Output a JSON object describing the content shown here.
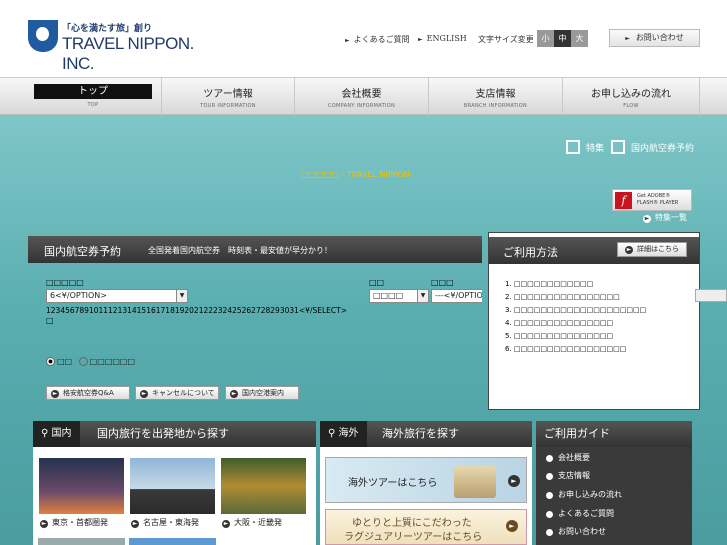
{
  "header": {
    "logo_tagline": "「心を満たす旅」創り",
    "logo_text": "TRAVEL NIPPON. INC.",
    "links": [
      "よくあるご質問",
      "ENGLISH"
    ],
    "font_size_label": "文字サイズ変更",
    "font_sizes": [
      "小",
      "中",
      "大"
    ],
    "contact_label": "お問い合わせ"
  },
  "nav": [
    {
      "jp": "トップ",
      "en": "TOP",
      "active": true
    },
    {
      "jp": "ツアー情報",
      "en": "TOUR INFORMATION"
    },
    {
      "jp": "会社概要",
      "en": "COMPANY INFORMATION"
    },
    {
      "jp": "支店情報",
      "en": "BRANCH INFORMATION"
    },
    {
      "jp": "お申し込みの流れ",
      "en": "FLOW"
    }
  ],
  "hero": {
    "checks": [
      "特集",
      "国内航空券予約"
    ],
    "caption": "□□□□□ - TRAVEL NIPPON-",
    "flash_line1": "Get ADOBE®",
    "flash_line2": "FLASH® PLAYER",
    "feature_list": "特集一覧"
  },
  "air": {
    "title": "国内航空券予約",
    "subtitle": "全国発着国内航空券　時刻表・最安値が早分かり！",
    "label_date": "□□□□□",
    "month_value": "6<¥/OPTION>",
    "label_from": "□□",
    "label_to": "□□□",
    "from_value": "□□□□",
    "to_value": "---<¥/OPTION",
    "days_text": "12345678910111213141516171819202122232425262728293031<¥/SELECT>",
    "days_tail": "□",
    "radio_1": "□□",
    "radio_2": "□□□□□□",
    "buttons": [
      "格安航空券Q&A",
      "キャンセルについて",
      "国内空港案内"
    ]
  },
  "usage": {
    "title": "ご利用方法",
    "details": "詳細はこちら",
    "lines": [
      "1. □□□□□□□□□□□□",
      "2. □□□□□□□□□□□□□□□□",
      "3. □□□□□□□□□□□□□□□□□□□□",
      "4. □□□□□□□□□□□□□□□",
      "5. □□□□□□□□□□□□□□□",
      "6. □□□□□□□□□□□□□□□□□"
    ]
  },
  "domestic": {
    "tag": "国内",
    "title": "国内旅行を出発地から探す",
    "areas": [
      "東京・首都圏発",
      "名古屋・東海発",
      "大阪・近畿発"
    ]
  },
  "international": {
    "tag": "海外",
    "title": "海外旅行を探す",
    "banner1": "海外ツアーはこちら",
    "banner2_line1": "ゆとりと上質にこだわった",
    "banner2_line2": "ラグジュアリーツアーはこちら"
  },
  "guide": {
    "title": "ご利用ガイド",
    "items": [
      "会社概要",
      "支店情報",
      "お申し込みの流れ",
      "よくあるご質問",
      "お問い合わせ"
    ]
  }
}
